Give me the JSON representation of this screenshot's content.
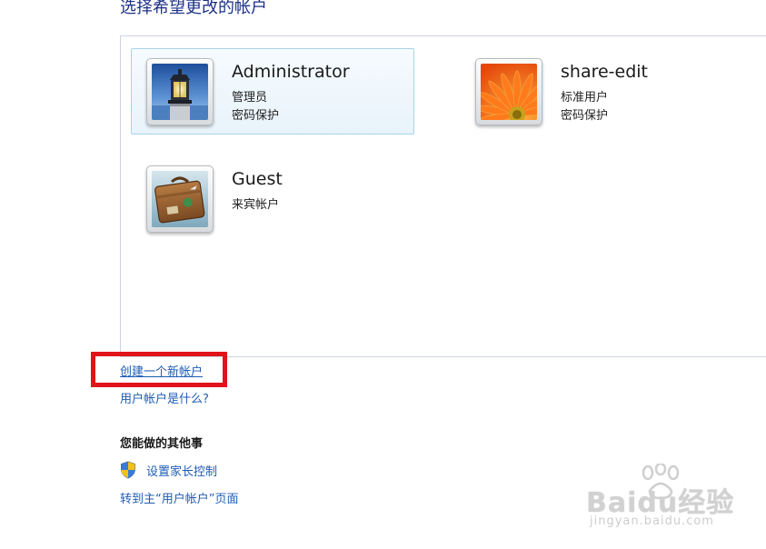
{
  "page": {
    "title": "选择希望更改的帐户"
  },
  "accounts": [
    {
      "name": "Administrator",
      "type": "管理员",
      "protection": "密码保护",
      "avatar_icon": "lighthouse-icon",
      "selected": true
    },
    {
      "name": "share-edit",
      "type": "标准用户",
      "protection": "密码保护",
      "avatar_icon": "flower-icon",
      "selected": false
    },
    {
      "name": "Guest",
      "type": "来宾帐户",
      "protection": "",
      "avatar_icon": "suitcase-icon",
      "selected": false
    }
  ],
  "links": {
    "create_account": "创建一个新帐户",
    "what_is_account": "用户帐户是什么?"
  },
  "other_tasks": {
    "heading": "您能做的其他事",
    "parental_controls": "设置家长控制",
    "go_to_main": "转到主“用户帐户”页面"
  },
  "watermark": {
    "brand": "Baidu经验",
    "url": "jingyan.baidu.com"
  },
  "colors": {
    "link": "#1e5cb3",
    "title": "#1e3287",
    "highlight_box": "#e0141a",
    "selected_tile_border": "#a9d4ea"
  }
}
